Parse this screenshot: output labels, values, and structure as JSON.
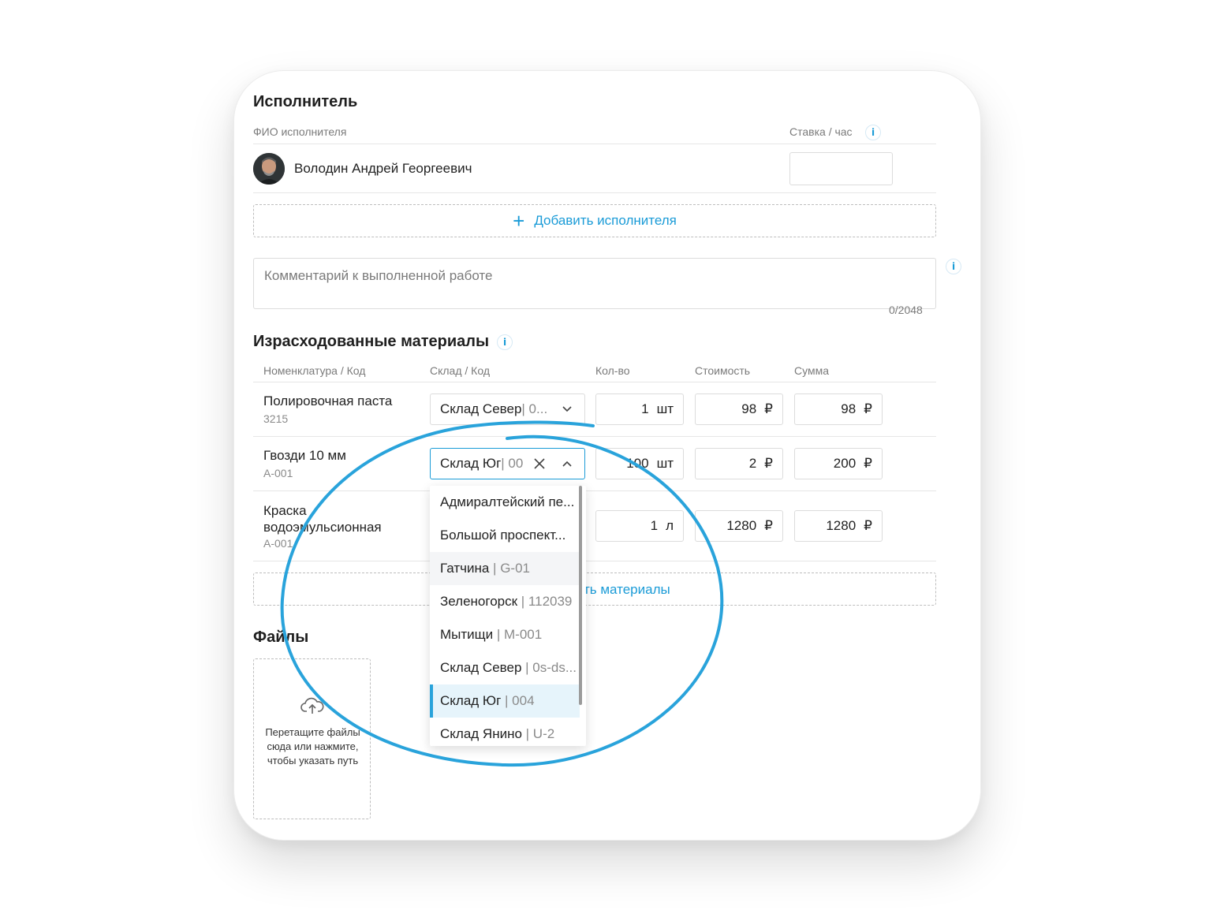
{
  "performer": {
    "title": "Исполнитель",
    "col_name": "ФИО исполнителя",
    "col_rate": "Ставка / час",
    "name": "Володин Андрей Георгеевич",
    "rate_value": "",
    "add_label": "Добавить исполнителя"
  },
  "comment": {
    "placeholder": "Комментарий к выполненной работе",
    "counter": "0/2048"
  },
  "materials": {
    "title": "Израсходованные материалы",
    "headers": [
      "Номенклатура / Код",
      "Склад / Код",
      "Кол-во",
      "Стоимость",
      "Сумма"
    ],
    "rows": [
      {
        "name": "Полировочная паста",
        "code": "3215",
        "warehouse": "Склад Север",
        "warehouse_code": " | 0...",
        "qty": "1",
        "unit": "шт",
        "price": "98",
        "sum": "98"
      },
      {
        "name": "Гвозди 10 мм",
        "code": "А-001",
        "warehouse": "Склад Юг",
        "warehouse_code": " | 00",
        "qty": "100",
        "unit": "шт",
        "price": "2",
        "sum": "200"
      },
      {
        "name": "Краска водоэмульсионная",
        "code": "А-001",
        "warehouse": "",
        "warehouse_code": "",
        "qty": "1",
        "unit": "л",
        "price": "1280",
        "sum": "1280"
      }
    ],
    "currency": "₽",
    "add_label": "Добавить материалы",
    "add_label_visible": "ть материалы"
  },
  "dropdown": {
    "items": [
      {
        "name": "Адмиралтейский пе...",
        "code": ""
      },
      {
        "name": "Большой проспект...",
        "code": ""
      },
      {
        "name": "Гатчина",
        "code": " | G-01"
      },
      {
        "name": "Зеленогорск",
        "code": " | 112039"
      },
      {
        "name": "Мытищи",
        "code": " | M-001"
      },
      {
        "name": "Склад Север",
        "code": " | 0s-ds..."
      },
      {
        "name": "Склад Юг",
        "code": " | 004"
      },
      {
        "name": "Склад Янино",
        "code": " | U-2"
      }
    ],
    "selected_index": 6,
    "hover_index": 2
  },
  "files": {
    "title": "Файлы",
    "drop_text": "Перетащите файлы сюда или нажмите, чтобы указать путь"
  },
  "colors": {
    "accent": "#1a9bd7",
    "highlight_circle": "#29a3db",
    "selected_bg": "#e6f4fb",
    "hover_bg": "#f4f5f7"
  }
}
